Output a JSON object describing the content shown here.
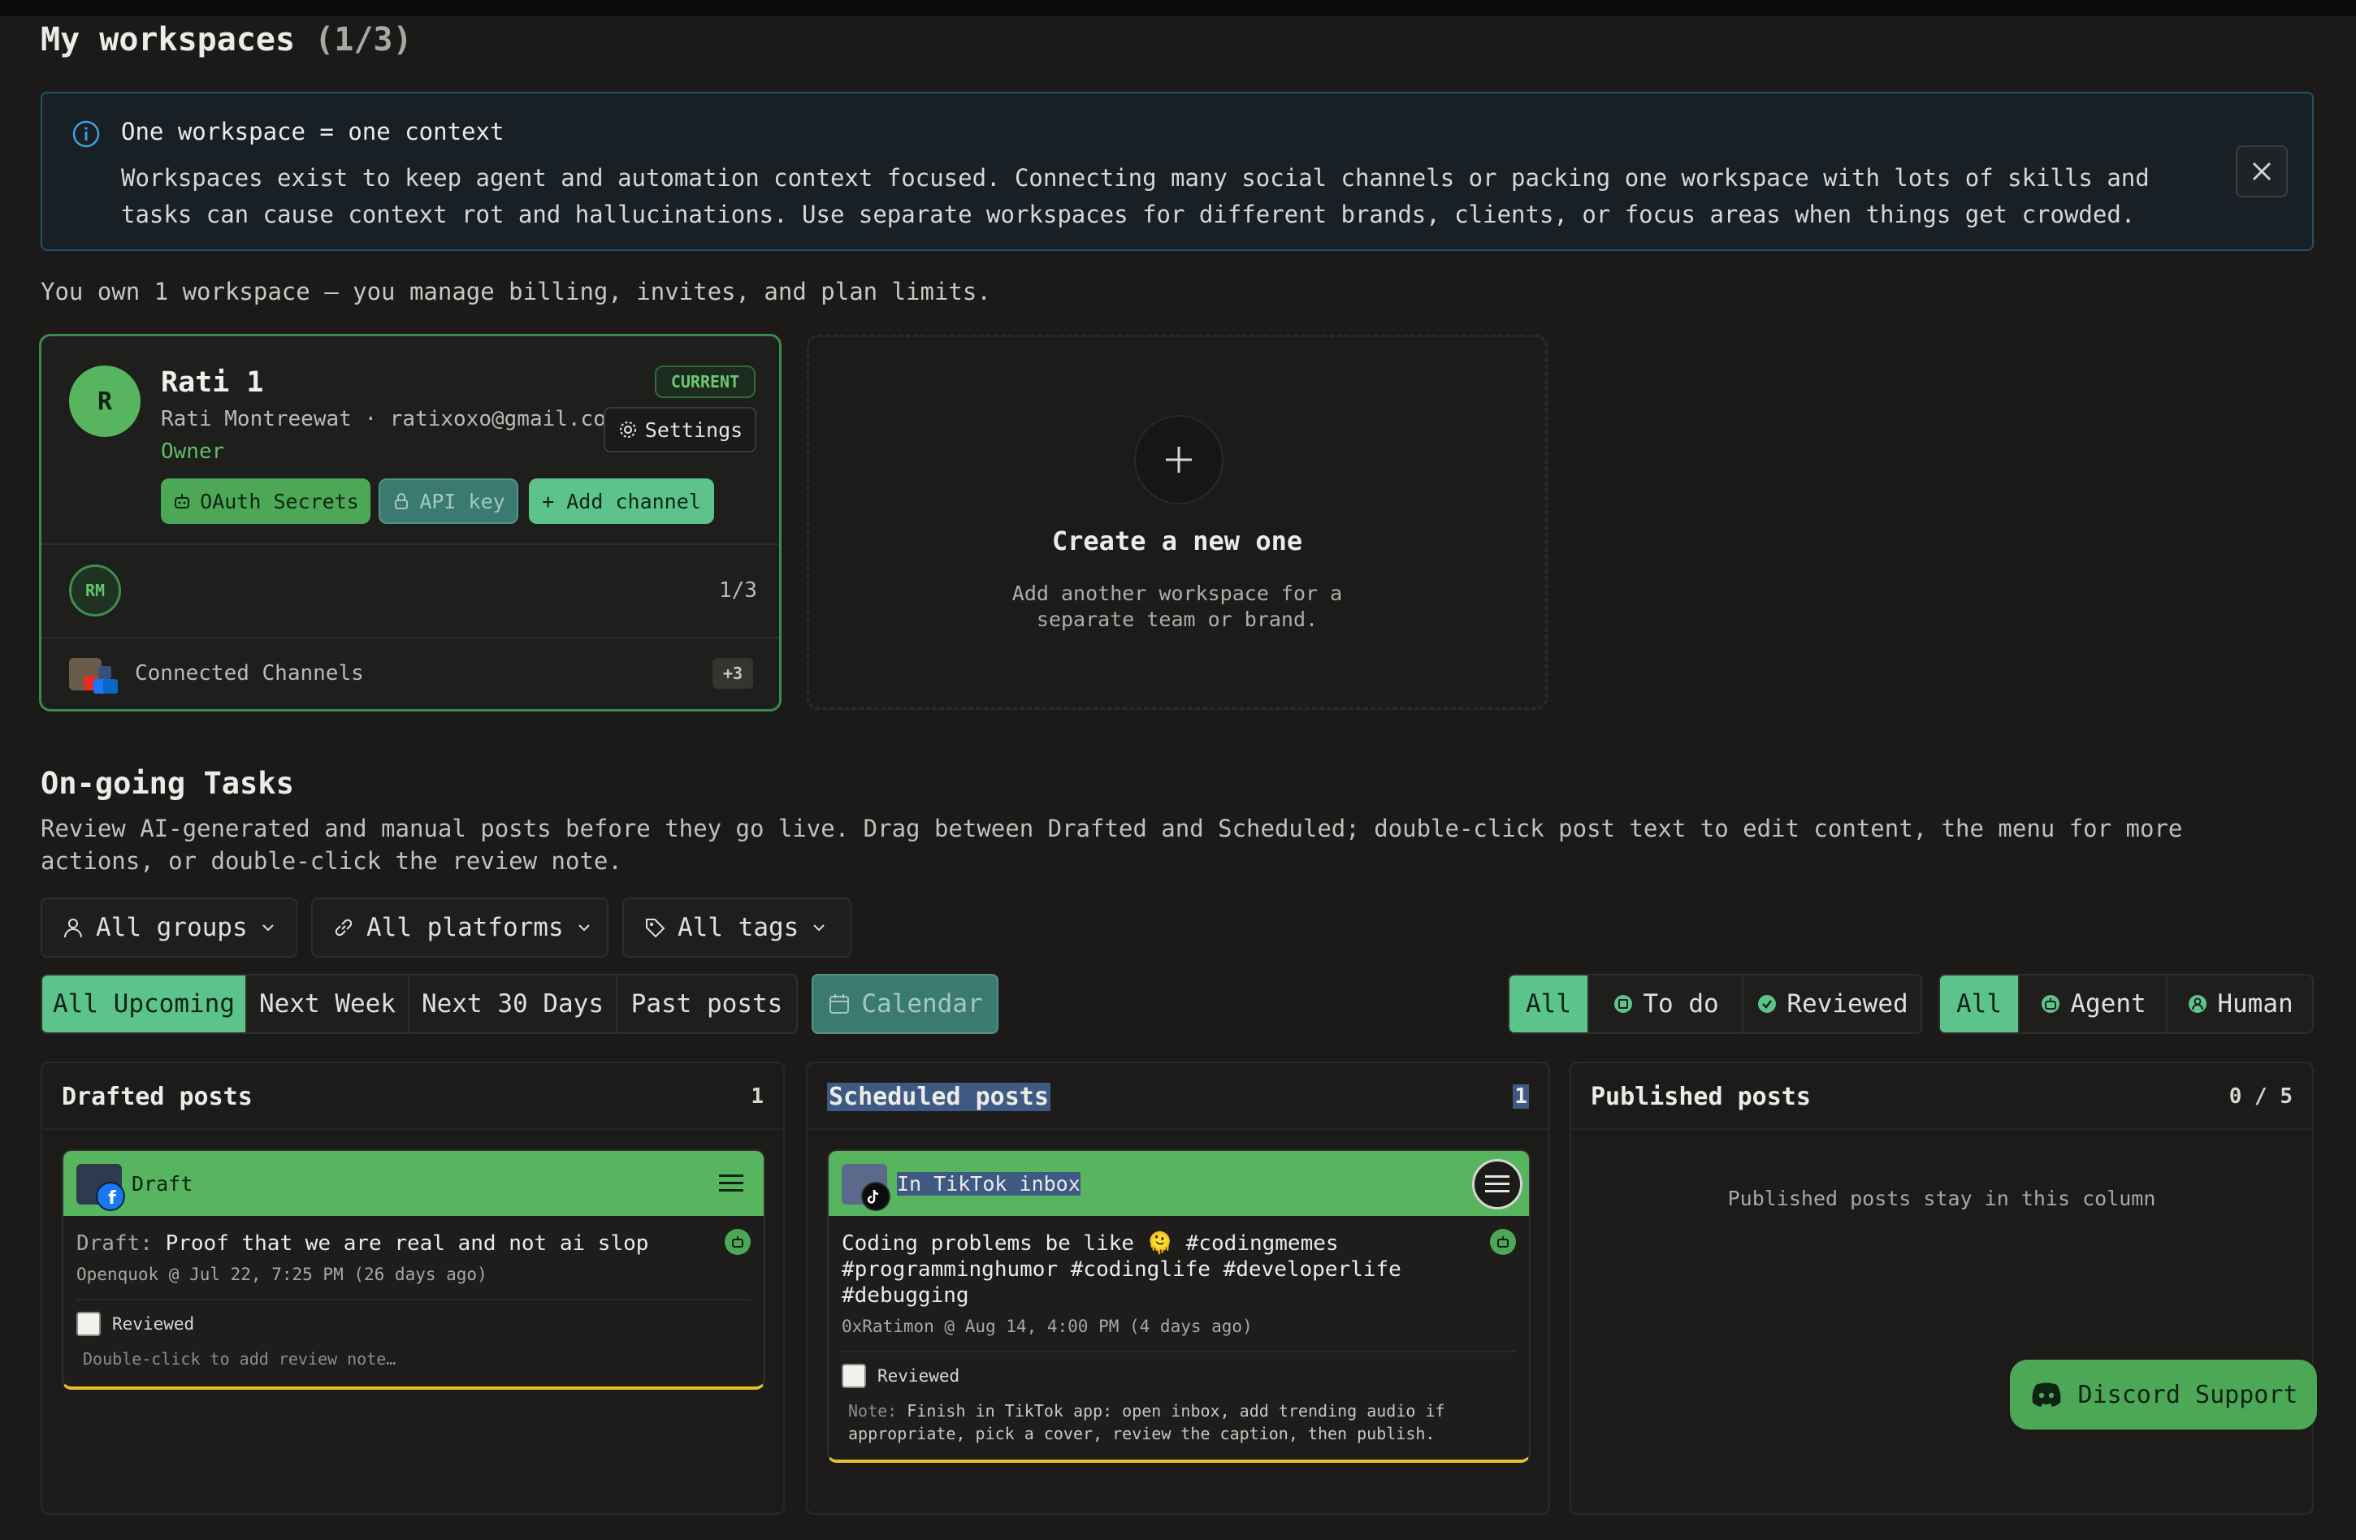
{
  "header": {
    "title": "My workspaces",
    "count": "(1/3)"
  },
  "info_banner": {
    "title": "One workspace = one context",
    "body": "Workspaces exist to keep agent and automation context focused. Connecting many social channels or packing one workspace with lots of skills and tasks can cause context rot and hallucinations. Use separate workspaces for different brands, clients, or focus areas when things get crowded."
  },
  "ownership_text": "You own 1 workspace — you manage billing, invites, and plan limits.",
  "workspace": {
    "avatar_letter": "R",
    "name": "Rati 1",
    "owner_line": "Rati Montreewat · ratixoxo@gmail.com",
    "role": "Owner",
    "badge": "CURRENT",
    "settings_label": "Settings",
    "oauth_label": "OAuth Secrets",
    "api_label": "API key",
    "add_channel_label": "+ Add channel",
    "member_initials": "RM",
    "member_count": "1/3",
    "channels_label": "Connected Channels",
    "extra_channels": "+3"
  },
  "create_card": {
    "title": "Create a new one",
    "subtitle": "Add another workspace for a separate team or brand."
  },
  "tasks": {
    "title": "On-going Tasks",
    "description": "Review AI-generated and manual posts before they go live. Drag between Drafted and Scheduled; double-click post text to edit content, the menu for more actions, or double-click the review note."
  },
  "filters": {
    "groups": "All groups",
    "platforms": "All platforms",
    "tags": "All tags"
  },
  "range_tabs": [
    "All Upcoming",
    "Next Week",
    "Next 30 Days",
    "Past posts"
  ],
  "calendar_label": "Calendar",
  "review_tabs": [
    "All",
    "To do",
    "Reviewed"
  ],
  "author_tabs": [
    "All",
    "Agent",
    "Human"
  ],
  "columns": {
    "drafted": {
      "title": "Drafted posts",
      "count": "1",
      "post": {
        "platform": "facebook",
        "status": "Draft",
        "prefix": "Draft:",
        "text": "Proof that we are real and not ai slop",
        "meta": "Openquok @ Jul 22, 7:25 PM (26 days ago)",
        "reviewed_label": "Reviewed",
        "note": "Double-click to add review note…"
      }
    },
    "scheduled": {
      "title": "Scheduled posts",
      "count": "1",
      "post": {
        "platform": "tiktok",
        "status": "In TikTok inbox",
        "text": "Coding problems be like 🫠 #codingmemes #programminghumor #codinglife #developerlife #debugging",
        "meta": "0xRatimon @ Aug 14, 4:00 PM (4 days ago)",
        "reviewed_label": "Reviewed",
        "note_prefix": "Note:",
        "note": "Finish in TikTok app: open inbox, add trending audio if appropriate, pick a cover, review the caption, then publish."
      }
    },
    "published": {
      "title": "Published posts",
      "count": "0 / 5",
      "empty": "Published posts stay in this column"
    }
  },
  "discord_label": "Discord Support",
  "colors": {
    "accent": "#5cc48b",
    "card_head": "#57b560",
    "highlight": "#e4c12e"
  }
}
